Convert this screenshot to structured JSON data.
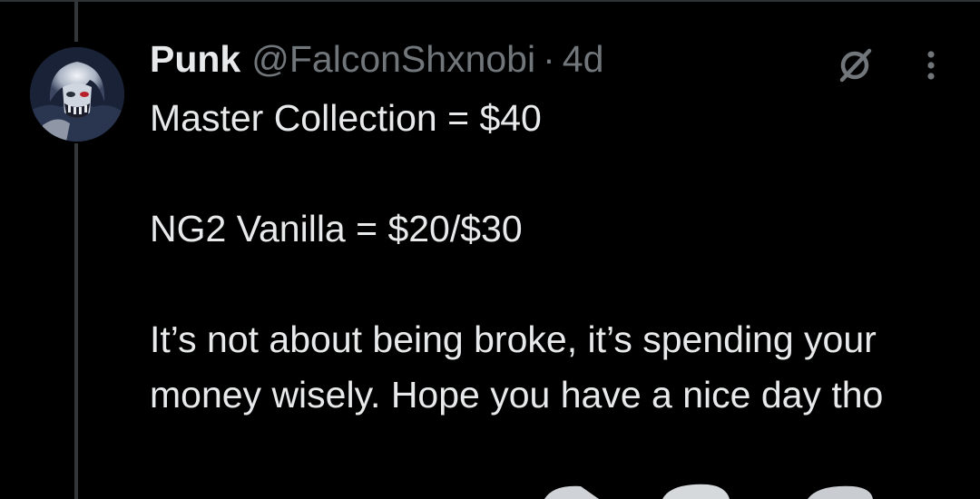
{
  "tweet": {
    "author_name": "Punk",
    "handle": "@FalconShxnobi",
    "separator": "·",
    "time": "4d",
    "paragraphs": [
      "Master Collection = $40",
      "NG2 Vanilla = $20/$30",
      "It’s not about being broke, it’s spending your money wisely. Hope you have a nice day tho"
    ]
  },
  "icons": {
    "grok": "grok-icon",
    "more": "more-options-icon",
    "avatar": "profile-avatar"
  },
  "colors": {
    "background": "#000000",
    "primary_text": "#e7e9ea",
    "secondary_text": "#71767b",
    "thread_line": "#333639"
  }
}
